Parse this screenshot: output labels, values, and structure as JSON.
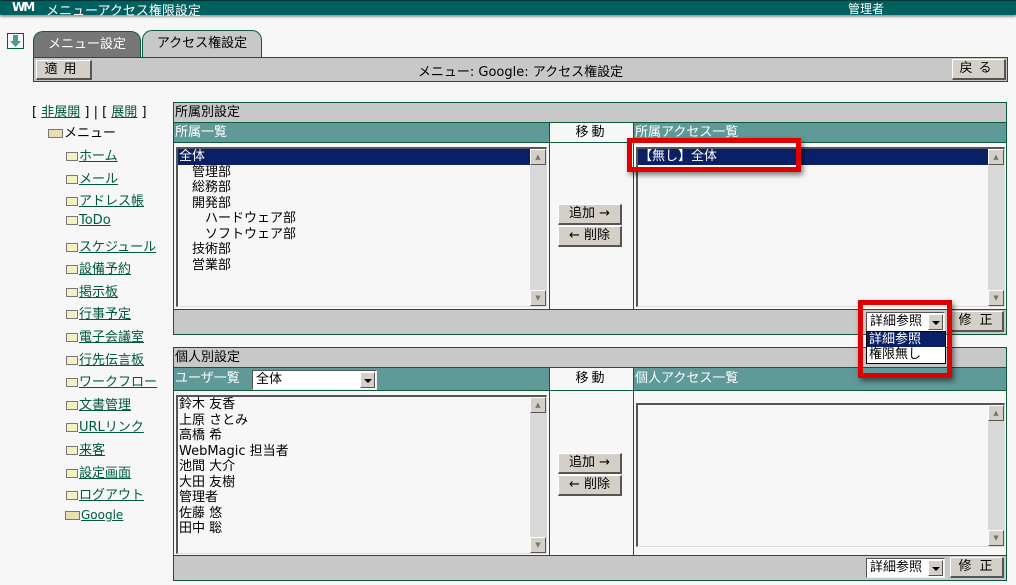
{
  "window": {
    "logo": "WM",
    "title": "メニューアクセス権限設定",
    "user": "管理者"
  },
  "tabs": [
    {
      "label": "メニュー設定",
      "active": false
    },
    {
      "label": "アクセス権設定",
      "active": true
    }
  ],
  "toolbar": {
    "apply_label": "適用",
    "heading": "メニュー: Google: アクセス権設定",
    "back_label": "戻る"
  },
  "tree": {
    "collapse_label": "非展開",
    "expand_label": "展開",
    "root_label": "メニュー",
    "items": [
      "ホーム",
      "メール",
      "アドレス帳",
      "ToDo",
      "スケジュール",
      "設備予約",
      "掲示板",
      "行事予定",
      "電子会議室",
      "行先伝言板",
      "ワークフロー",
      "文書管理",
      "URLリンク",
      "来客",
      "設定画面",
      "ログアウト",
      "Google"
    ]
  },
  "group_section": {
    "title": "所属別設定",
    "list_header": "所属一覧",
    "move_header": "移動",
    "access_header": "所属アクセス一覧",
    "groups": [
      "全体",
      "　管理部",
      "　総務部",
      "　開発部",
      "　　ハードウェア部",
      "　　ソフトウェア部",
      "　技術部",
      "　営業部"
    ],
    "selected_group": "全体",
    "access_items": [
      "【無し】全体"
    ],
    "add_label": "追加 →",
    "remove_label": "← 削除",
    "permission_select": "詳細参照",
    "permission_options": [
      "詳細参照",
      "権限無し"
    ],
    "fix_label": "修正"
  },
  "user_section": {
    "title": "個人別設定",
    "list_header": "ユーザ一覧",
    "filter_value": "全体",
    "move_header": "移動",
    "access_header": "個人アクセス一覧",
    "users": [
      "鈴木 友香",
      "上原 さとみ",
      "高橋 希",
      "WebMagic 担当者",
      "池間 大介",
      "大田 友樹",
      "管理者",
      "佐藤 悠",
      "田中 聡"
    ],
    "access_items": [],
    "add_label": "追加 →",
    "remove_label": "← 削除",
    "permission_select": "詳細参照",
    "fix_label": "修正"
  },
  "colors": {
    "titlebar": "#006060",
    "header": "#5f9a98",
    "selection": "#0a1f66",
    "highlight": "#e00000",
    "link": "#005a3a"
  }
}
